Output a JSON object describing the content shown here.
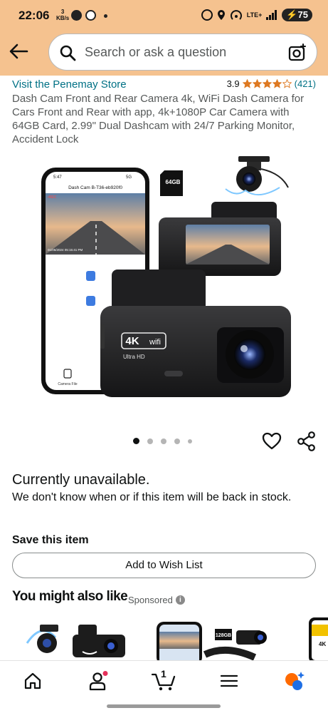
{
  "status_bar": {
    "time": "22:06",
    "net_speed_value": "3",
    "net_speed_unit": "KB/s",
    "network": "LTE+",
    "battery": "75"
  },
  "search": {
    "placeholder": "Search or ask a question"
  },
  "product": {
    "store_link": "Visit the Penemay Store",
    "rating": "3.9",
    "rating_stars": 3.9,
    "review_count": "(421)",
    "title": "Dash Cam Front and Rear Camera 4k, WiFi Dash Camera for Cars Front and Rear with app, 4k+1080P Car Camera with 64GB Card, 2.99\" Dual Dashcam with 24/7 Parking Monitor, Accident Lock"
  },
  "product_image": {
    "phone_time": "5:47",
    "phone_signal": "5G",
    "phone_header": "Dash Cam B-T36-eb920f0",
    "phone_rec": "•REC",
    "phone_timestamp": "01/06/2024 05:15:41 PM",
    "phone_bottom_label": "Camera File",
    "sd_card_label": "64GB",
    "badge_4k": "4K",
    "badge_wifi": "wifi",
    "badge_uhd": "Ultra HD"
  },
  "carousel": {
    "image_count": 5,
    "active_index": 0
  },
  "availability": {
    "status": "Currently unavailable.",
    "message": "We don't know when or if this item will be back in stock."
  },
  "save": {
    "title": "Save this item",
    "button_label": "Add to Wish List"
  },
  "recommendations": {
    "title": "You might also like",
    "sponsored_label": "Sponsored",
    "info_glyph": "i",
    "item2_sd_label": "128GB",
    "item3_label": "4K"
  },
  "bottom_nav": {
    "cart_count": "1",
    "items": [
      "home-icon",
      "account-icon",
      "cart-icon",
      "menu-icon",
      "rufus-icon"
    ]
  },
  "colors": {
    "header_bg": "#f5c28f",
    "link": "#007185",
    "star": "#de7921",
    "notification_dot": "#e5305a"
  }
}
